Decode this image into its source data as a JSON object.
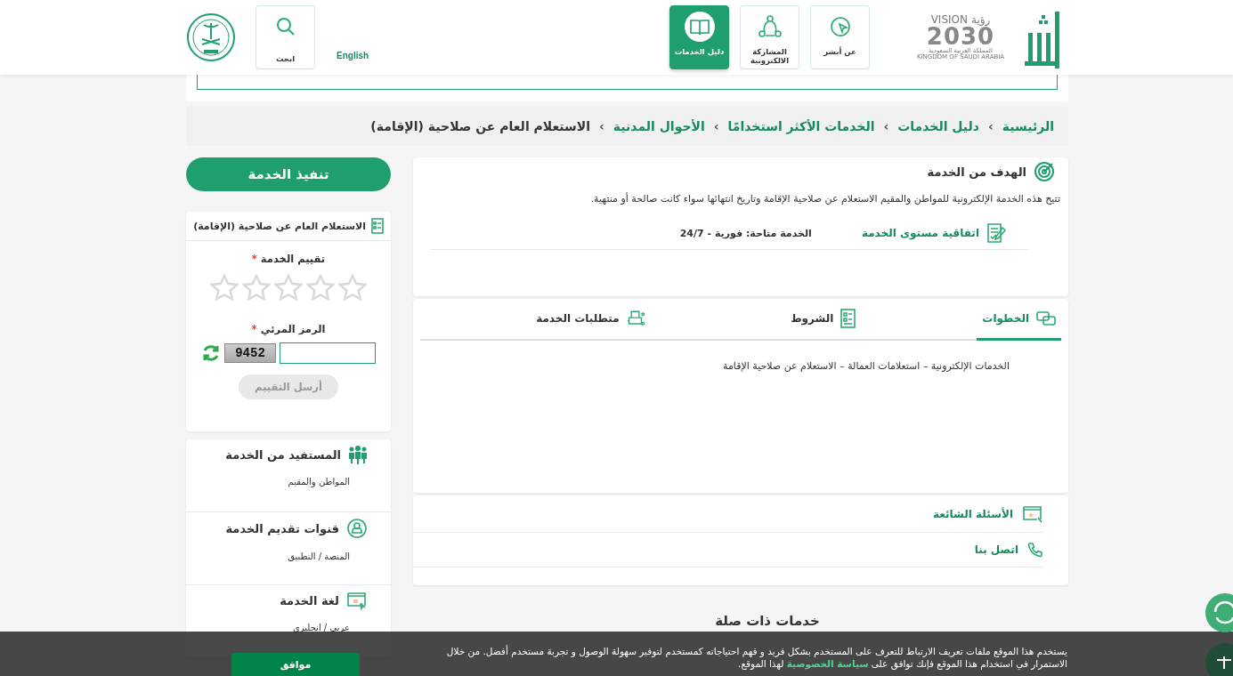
{
  "header": {
    "vision_logo": {
      "arabic": "رؤية",
      "word": "VISION",
      "year": "2030",
      "country_ar": "المملكة العربية السعودية",
      "country_en": "KINGDOM OF SAUDI ARABIA"
    },
    "nav": [
      {
        "label": "عن أبشر",
        "selected": false
      },
      {
        "label": "المشاركة الالكترونية",
        "selected": false
      },
      {
        "label": "دليل الخدمات",
        "selected": true
      }
    ],
    "language": "English",
    "search": "ابحث"
  },
  "breadcrumb": [
    {
      "label": "الرئيسية",
      "current": false
    },
    {
      "label": "دليل الخدمات",
      "current": false
    },
    {
      "label": "الخدمات الأكثر استخدامًا",
      "current": false
    },
    {
      "label": "الأحوال المدنية",
      "current": false
    },
    {
      "label": "الاستعلام العام عن صلاحية (الإقامة)",
      "current": true
    }
  ],
  "separator": "›",
  "goal": {
    "title": "الهدف من الخدمة",
    "description": "تتيح هذه الخدمة الإلكترونية للمواطن والمقيم الاستعلام عن صلاحية الإقامة وتاريخ انتهائها سواء كانت صالحة أو منتهية.",
    "sla_label": "اتفاقية مستوى الخدمة",
    "sla_value": "الخدمة متاحة: فورية - 24/7"
  },
  "tabs": [
    {
      "label": "الخطوات",
      "selected": true
    },
    {
      "label": "الشروط",
      "selected": false
    },
    {
      "label": "متطلبات الخدمة",
      "selected": false
    }
  ],
  "tab_content": "الخدمات الإلكترونية – استعلامات العمالة – الاستعلام عن صلاحية الإقامة",
  "links": [
    {
      "label": "الأسئلة الشائعة"
    },
    {
      "label": "اتصل بنا"
    }
  ],
  "related_title": "خدمات ذات صلة",
  "execute_button": "تنفيذ الخدمة",
  "rating_card": {
    "title": "الاستعلام العام عن صلاحية (الإقامة)",
    "rating_label": "تقييم الخدمة",
    "required_mark": "*",
    "stars": 0,
    "captcha_label": "الرمز المرئي",
    "captcha_code": "9452",
    "submit": "أرسل التقييم",
    "submit_disabled": true
  },
  "info": [
    {
      "title": "المستفيد من الخدمة",
      "value": "المواطن والمقيم"
    },
    {
      "title": "قنوات تقديم الخدمة",
      "value": "المنصة / التطبيق"
    },
    {
      "title": "لغة الخدمة",
      "value": "عربي / انجليزي"
    }
  ],
  "cookie": {
    "text_before": "يستخدم هذا الموقع ملفات تعريف الارتباط للتعرف على المستخدم بشكل فريد و فهم احتياجاته كمستخدم لتوفير سهولة الوصول و تجربة مستخدم أفضل. من خلال الاستمرار في استخدام هذا الموقع فإنك توافق على ",
    "link": "سياسة الخصوصية",
    "text_after": " لهذا الموقع.",
    "accept": "موافق"
  }
}
